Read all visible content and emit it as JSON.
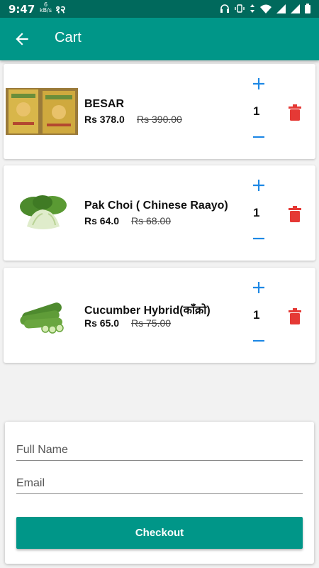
{
  "status_bar": {
    "time": "9:47",
    "speed_value": "6",
    "speed_unit": "kB/s",
    "extra": "१२"
  },
  "app_bar": {
    "title": "Cart",
    "back_icon": "arrow-left-icon"
  },
  "cart": {
    "items": [
      {
        "name": "BESAR",
        "price": "Rs 378.0",
        "old_price": "Rs 390.00",
        "quantity": "1"
      },
      {
        "name": "Pak Choi ( Chinese Raayo)",
        "price": "Rs 64.0",
        "old_price": "Rs 68.00",
        "quantity": "1"
      },
      {
        "name": "Cucumber Hybrid(काँक्रो)",
        "price": "Rs 65.0",
        "old_price": "Rs 75.00",
        "quantity": "1"
      }
    ]
  },
  "form": {
    "full_name_placeholder": "Full Name",
    "email_placeholder": "Email",
    "checkout_label": "Checkout"
  },
  "colors": {
    "primary": "#009688",
    "primary_dark": "#00695c",
    "accent_blue": "#1e88e5",
    "delete_red": "#e53935"
  }
}
